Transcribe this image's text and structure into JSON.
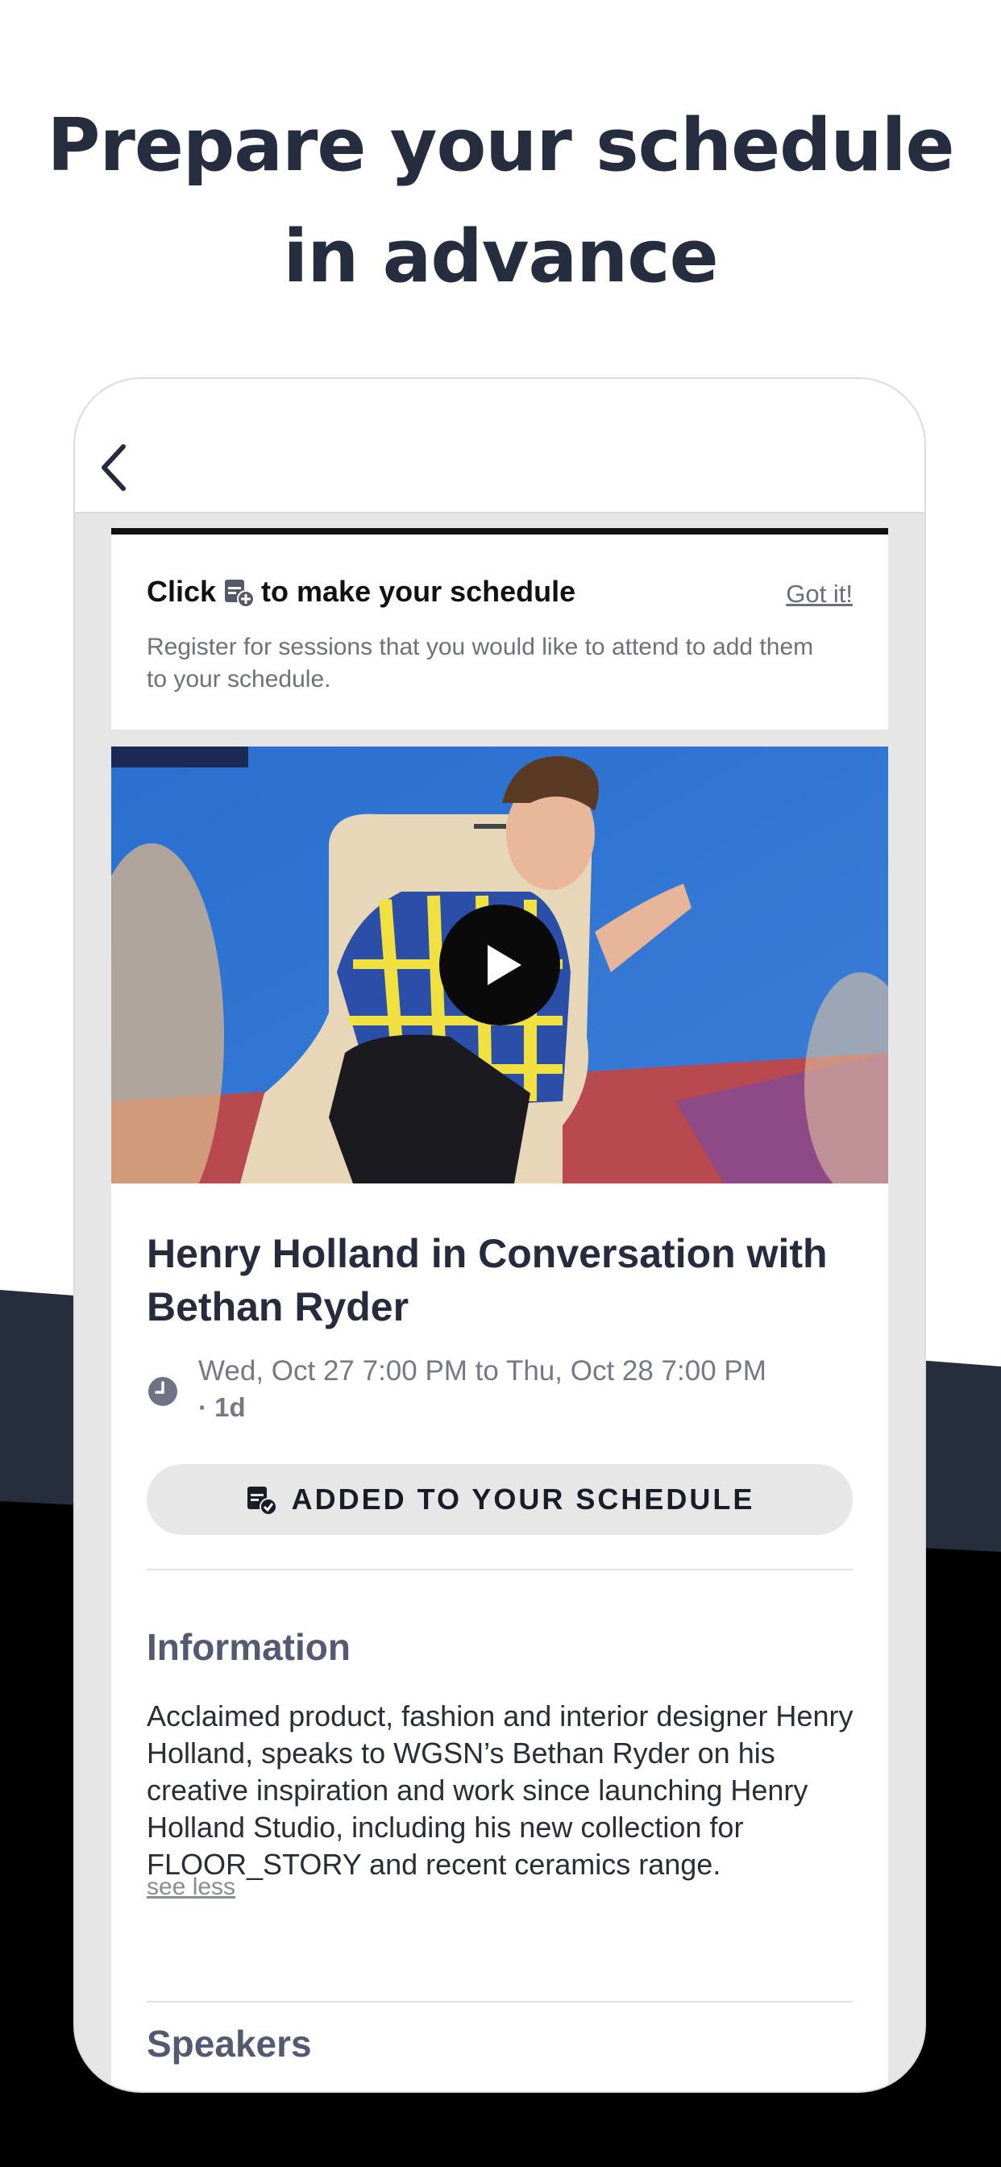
{
  "headline": "Prepare your schedule in advance",
  "tip": {
    "title_prefix": "Click",
    "title_suffix": "to make your schedule",
    "dismiss": "Got it!",
    "body": "Register for sessions that you would like to attend to add them to your schedule."
  },
  "session": {
    "title": "Henry Holland in Conversation with Bethan Ryder",
    "time": "Wed, Oct 27 7:00 PM to Thu, Oct 28 7:00 PM",
    "duration": "· 1d",
    "schedule_button": "ADDED TO YOUR SCHEDULE"
  },
  "information": {
    "heading": "Information",
    "body": "Acclaimed product, fashion and interior designer Henry Holland, speaks to WGSN’s Bethan Ryder on his creative inspiration and work since launching Henry Holland Studio, including his new collection for FLOOR_STORY and recent ceramics range.",
    "toggle": "see less"
  },
  "speakers": {
    "heading": "Speakers"
  },
  "icons": {
    "back": "chevron-left-icon",
    "add_schedule": "calendar-add-icon",
    "added_schedule": "calendar-check-icon",
    "clock": "clock-icon",
    "play": "play-icon"
  },
  "colors": {
    "headline": "#262d3f",
    "dark_band": "#262d3d",
    "card_background": "#e6e6e6",
    "section_heading": "#545a72"
  }
}
